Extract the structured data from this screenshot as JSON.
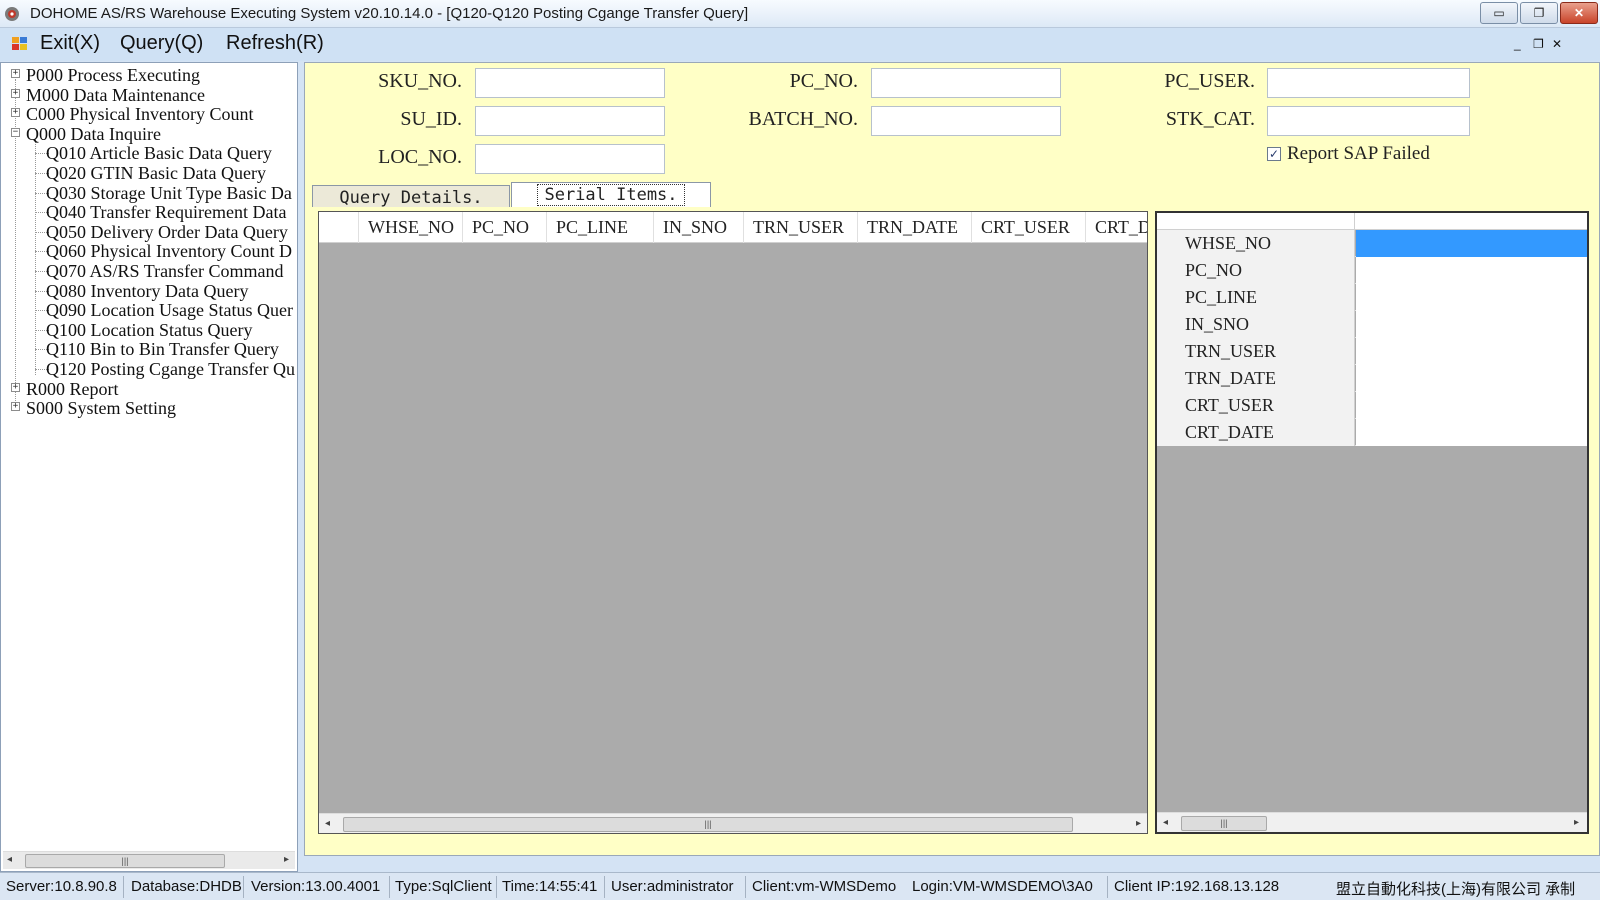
{
  "window": {
    "title": "DOHOME AS/RS Warehouse Executing System v20.10.14.0 - [Q120-Q120 Posting Cgange Transfer Query]",
    "min_glyph": "▭",
    "max_glyph": "❐",
    "close_glyph": "✕"
  },
  "menu": {
    "exit": "Exit(X)",
    "query": "Query(Q)",
    "refresh": "Refresh(R)",
    "mdi_min": "_",
    "mdi_restore": "❐",
    "mdi_close": "✕"
  },
  "tree": {
    "items": [
      {
        "label": "P000 Process Executing",
        "state": "collapsed"
      },
      {
        "label": "M000 Data Maintenance",
        "state": "collapsed"
      },
      {
        "label": "C000 Physical Inventory Count",
        "state": "collapsed"
      },
      {
        "label": "Q000 Data Inquire",
        "state": "expanded"
      },
      {
        "label": "Q010 Article Basic Data Query"
      },
      {
        "label": "Q020 GTIN Basic Data Query"
      },
      {
        "label": "Q030 Storage Unit Type Basic Da"
      },
      {
        "label": "Q040 Transfer Requirement Data"
      },
      {
        "label": "Q050 Delivery Order Data Query"
      },
      {
        "label": "Q060 Physical Inventory Count D"
      },
      {
        "label": "Q070 AS/RS Transfer Command"
      },
      {
        "label": "Q080 Inventory Data Query"
      },
      {
        "label": "Q090 Location Usage Status Quer"
      },
      {
        "label": "Q100 Location Status Query"
      },
      {
        "label": "Q110 Bin to Bin Transfer Query"
      },
      {
        "label": "Q120 Posting Cgange Transfer Qu"
      },
      {
        "label": "R000 Report",
        "state": "collapsed"
      },
      {
        "label": "S000 System Setting",
        "state": "collapsed"
      }
    ],
    "plus": "+",
    "minus": "−",
    "scroll_grip": "|||"
  },
  "form": {
    "sku_no": {
      "label": "SKU_NO.",
      "value": ""
    },
    "pc_no": {
      "label": "PC_NO.",
      "value": ""
    },
    "pc_user": {
      "label": "PC_USER.",
      "value": ""
    },
    "su_id": {
      "label": "SU_ID.",
      "value": ""
    },
    "batch_no": {
      "label": "BATCH_NO.",
      "value": ""
    },
    "stk_cat": {
      "label": "STK_CAT.",
      "value": ""
    },
    "loc_no": {
      "label": "LOC_NO.",
      "value": ""
    },
    "report_sap_failed": {
      "label": "Report SAP Failed",
      "checked": true,
      "glyph": "✓"
    }
  },
  "tabs": [
    {
      "label": "Query Details.",
      "active": false
    },
    {
      "label": "Serial Items.",
      "active": true
    }
  ],
  "left_grid": {
    "columns": [
      "WHSE_NO",
      "PC_NO",
      "PC_LINE",
      "IN_SNO",
      "TRN_USER",
      "TRN_DATE",
      "CRT_USER",
      "CRT_D"
    ],
    "rows": [],
    "scroll_grip": "|||"
  },
  "right_grid": {
    "fields": [
      "WHSE_NO",
      "PC_NO",
      "PC_LINE",
      "IN_SNO",
      "TRN_USER",
      "TRN_DATE",
      "CRT_USER",
      "CRT_DATE"
    ],
    "current_marker": "▸",
    "new_marker": "•",
    "scroll_grip": "|||"
  },
  "status": {
    "server": "Server:10.8.90.8",
    "database": "Database:DHDB",
    "version": "Version:13.00.4001",
    "type": "Type:SqlClient",
    "time": "Time:14:55:41",
    "user": "User:administrator",
    "client": "Client:vm-WMSDemo",
    "login": "Login:VM-WMSDEMO\\3A0",
    "client_ip": "Client IP:192.168.13.128",
    "vendor": "盟立自動化科技(上海)有限公司 承制"
  },
  "colors": {
    "form_bg": "#ffffc6",
    "selected_cell": "#3399ff",
    "grid_empty": "#ababab"
  }
}
